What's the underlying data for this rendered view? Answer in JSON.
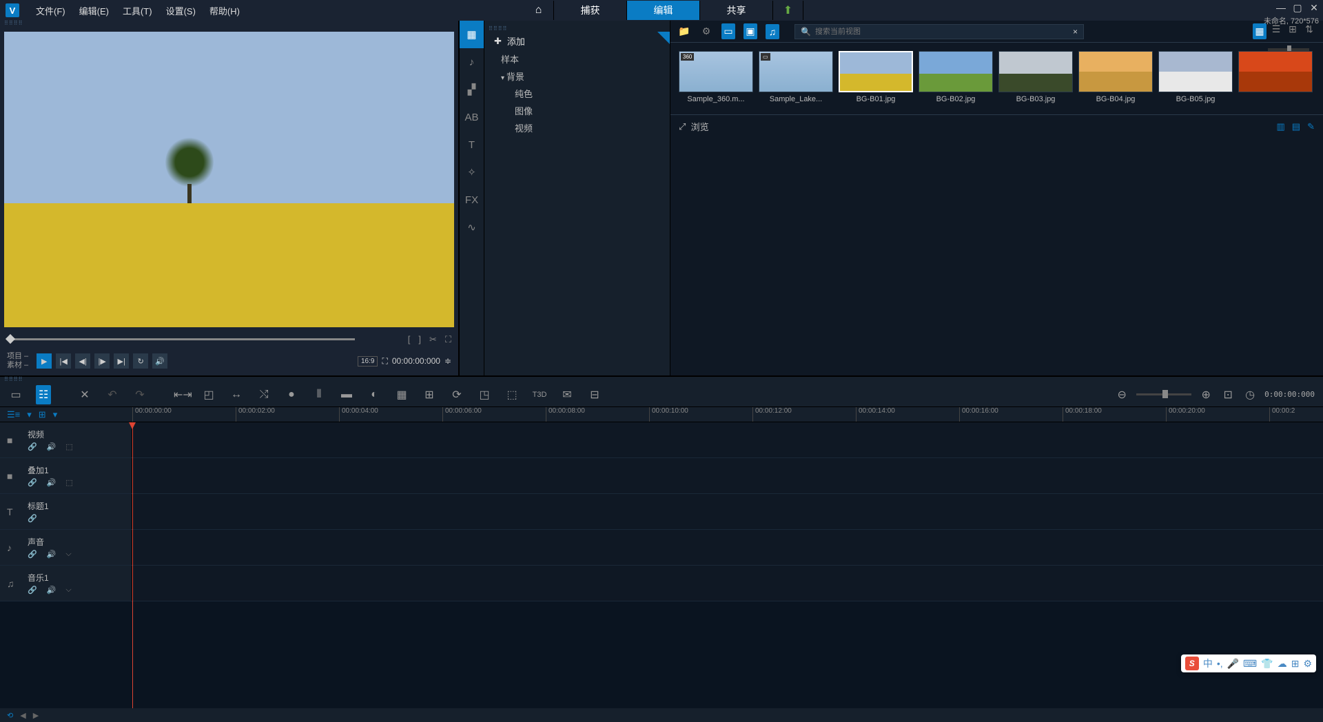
{
  "menus": {
    "file": "文件(F)",
    "edit": "编辑(E)",
    "tools": "工具(T)",
    "settings": "设置(S)",
    "help": "帮助(H)"
  },
  "tabs": {
    "capture": "捕获",
    "edit": "编辑",
    "share": "共享"
  },
  "title_info": "未命名, 720*576",
  "preview": {
    "project_label": "项目",
    "clip_label": "素材",
    "timecode": "00:00:00:000",
    "aspect": "16:9"
  },
  "library": {
    "add": "添加",
    "tree": {
      "sample": "样本",
      "background": "背景",
      "solid": "纯色",
      "image": "图像",
      "video": "视频"
    },
    "search_placeholder": "搜索当前视图",
    "browse": "浏览",
    "thumbs": [
      {
        "name": "Sample_360.m..."
      },
      {
        "name": "Sample_Lake..."
      },
      {
        "name": "BG-B01.jpg",
        "selected": true
      },
      {
        "name": "BG-B02.jpg"
      },
      {
        "name": "BG-B03.jpg"
      },
      {
        "name": "BG-B04.jpg"
      },
      {
        "name": "BG-B05.jpg"
      }
    ]
  },
  "timeline": {
    "ruler": [
      "00:00:00:00",
      "00:00:02:00",
      "00:00:04:00",
      "00:00:06:00",
      "00:00:08:00",
      "00:00:10:00",
      "00:00:12:00",
      "00:00:14:00",
      "00:00:16:00",
      "00:00:18:00",
      "00:00:20:00",
      "00:00:2"
    ],
    "tc_display": "0:00:00:000",
    "tracks": [
      {
        "name": "视频",
        "icon": "■",
        "ctrls": [
          "🔗",
          "🔊",
          "⬚"
        ]
      },
      {
        "name": "叠加1",
        "icon": "■",
        "ctrls": [
          "🔗",
          "🔊",
          "⬚"
        ]
      },
      {
        "name": "标题1",
        "icon": "T",
        "ctrls": [
          "🔗"
        ]
      },
      {
        "name": "声音",
        "icon": "♪",
        "ctrls": [
          "🔗",
          "🔊",
          "⌵"
        ]
      },
      {
        "name": "音乐1",
        "icon": "♫",
        "ctrls": [
          "🔗",
          "🔊",
          "⌵"
        ]
      }
    ]
  },
  "ime": "中"
}
